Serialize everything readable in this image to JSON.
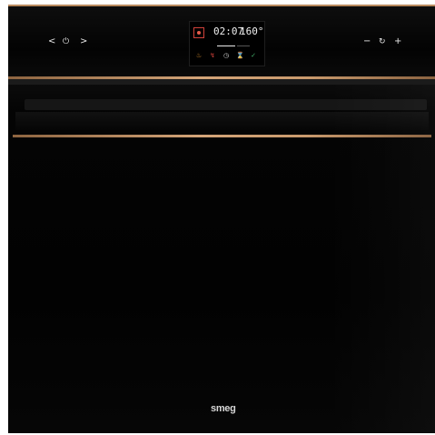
{
  "controls": {
    "left": {
      "prev": "<",
      "power": "⏻",
      "next": ">"
    },
    "right": {
      "minus": "−",
      "reset": "↻",
      "plus": "+"
    }
  },
  "display": {
    "time": "02:07",
    "temperature": "160°",
    "colors": {
      "fan": "#d0413a",
      "text": "#f1f1f1"
    },
    "icons": [
      {
        "name": "heating-icon",
        "glyph": "♨",
        "color": "#d18a2f"
      },
      {
        "name": "probe-icon",
        "glyph": "↯",
        "color": "#d0413a"
      },
      {
        "name": "clock-icon",
        "glyph": "◷",
        "color": "#cfcfcf"
      },
      {
        "name": "timer-icon",
        "glyph": "⌛",
        "color": "#3b7fd6"
      },
      {
        "name": "check-icon",
        "glyph": "✓",
        "color": "#43b06b"
      }
    ]
  },
  "door": {
    "brand_logo": "smeg",
    "trim_color": "#c99a6d"
  }
}
